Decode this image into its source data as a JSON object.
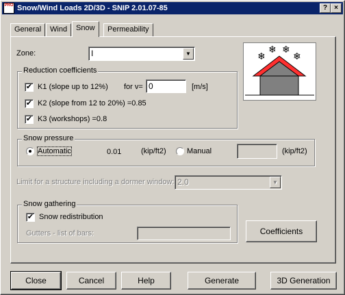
{
  "window": {
    "title": "Snow/Wind Loads 2D/3D - SNIP 2.01.07-85",
    "icon_text": "PRO",
    "help_glyph": "?",
    "close_glyph": "×"
  },
  "tabs": [
    {
      "label": "General"
    },
    {
      "label": "Wind"
    },
    {
      "label": "Snow"
    },
    {
      "label": "Permeability"
    }
  ],
  "zone": {
    "label": "Zone:",
    "value": "I"
  },
  "reduction": {
    "title": "Reduction coefficients",
    "k1_label": "K1 (slope up to 12%)",
    "k1_checked": true,
    "for_v_label": "for v=",
    "v_value": "0",
    "v_unit": "[m/s]",
    "k2_label": "K2 (slope from 12 to 20%) =0.85",
    "k2_checked": true,
    "k3_label": "K3 (workshops) =0.8",
    "k3_checked": true
  },
  "snow_pressure": {
    "title": "Snow pressure",
    "automatic_label": "Automatic",
    "automatic_selected": true,
    "automatic_value": "0.01",
    "unit_auto": "(kip/ft2)",
    "manual_label": "Manual",
    "manual_value": "",
    "unit_manual": "(kip/ft2)"
  },
  "dormer": {
    "label": "Limit for a structure including a dormer window:",
    "value": "2.0"
  },
  "gathering": {
    "title": "Snow gathering",
    "redistribution_label": "Snow redistribution",
    "redistribution_checked": true,
    "gutters_label": "Gutters - list of bars:",
    "gutters_value": ""
  },
  "buttons": {
    "coefficients": "Coefficients",
    "close": "Close",
    "cancel": "Cancel",
    "help": "Help",
    "generate": "Generate",
    "generation_3d": "3D Generation"
  },
  "icons": {
    "check": "✔",
    "dropdown": "▼",
    "snowflake": "❄"
  }
}
